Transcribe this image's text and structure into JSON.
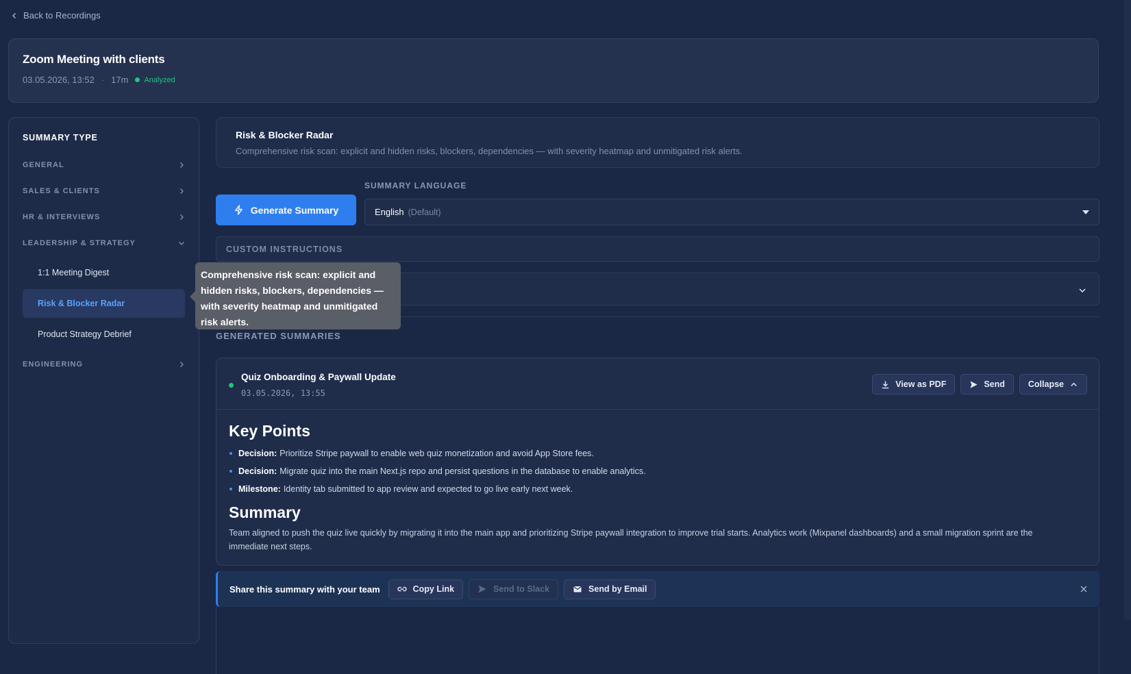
{
  "nav": {
    "back_label": "Back to Recordings"
  },
  "recording": {
    "title": "Zoom Meeting with clients",
    "datetime": "03.05.2026, 13:52",
    "separator": "·",
    "duration": "17m",
    "status": "Analyzed"
  },
  "sidebar": {
    "title": "SUMMARY TYPE",
    "categories": [
      {
        "label": "GENERAL"
      },
      {
        "label": "SALES & CLIENTS"
      },
      {
        "label": "HR & INTERVIEWS"
      },
      {
        "label": "LEADERSHIP & STRATEGY"
      },
      {
        "label": "ENGINEERING"
      }
    ],
    "leadership_items": [
      {
        "label": "1:1 Meeting Digest"
      },
      {
        "label": "Risk & Blocker Radar"
      },
      {
        "label": "Product Strategy Debrief"
      }
    ]
  },
  "tooltip": {
    "text": "Comprehensive risk scan: explicit and hidden risks, blockers, dependencies — with severity heatmap and unmitigated risk alerts."
  },
  "type_card": {
    "title": "Risk & Blocker Radar",
    "description": "Comprehensive risk scan: explicit and hidden risks, blockers, dependencies — with severity heatmap and unmitigated risk alerts."
  },
  "controls": {
    "generate_label": "Generate Summary",
    "language_label": "SUMMARY LANGUAGE",
    "language_value": "English",
    "language_default": "(Default)",
    "custom_instructions_label": "CUSTOM INSTRUCTIONS"
  },
  "generated": {
    "label": "GENERATED SUMMARIES",
    "summary": {
      "title": "Quiz Onboarding & Paywall Update",
      "date": "03.05.2026, 13:55",
      "buttons": {
        "pdf": "View as PDF",
        "send": "Send",
        "collapse": "Collapse"
      },
      "key_points_heading": "Key Points",
      "key_points": [
        {
          "tag": "Decision:",
          "text": "Prioritize Stripe paywall to enable web quiz monetization and avoid App Store fees."
        },
        {
          "tag": "Decision:",
          "text": "Migrate quiz into the main Next.js repo and persist questions in the database to enable analytics."
        },
        {
          "tag": "Milestone:",
          "text": "Identity tab submitted to app review and expected to go live early next week."
        }
      ],
      "summary_heading": "Summary",
      "summary_text": "Team aligned to push the quiz live quickly by migrating it into the main app and prioritizing Stripe paywall integration to improve trial starts. Analytics work (Mixpanel dashboards) and a small migration sprint are the immediate next steps."
    }
  },
  "share": {
    "text": "Share this summary with your team",
    "copy_link": "Copy Link",
    "send_slack": "Send to Slack",
    "send_email": "Send by Email"
  },
  "colors": {
    "accent": "#2f7ef0",
    "success": "#22c47e",
    "background": "#1b2845"
  }
}
